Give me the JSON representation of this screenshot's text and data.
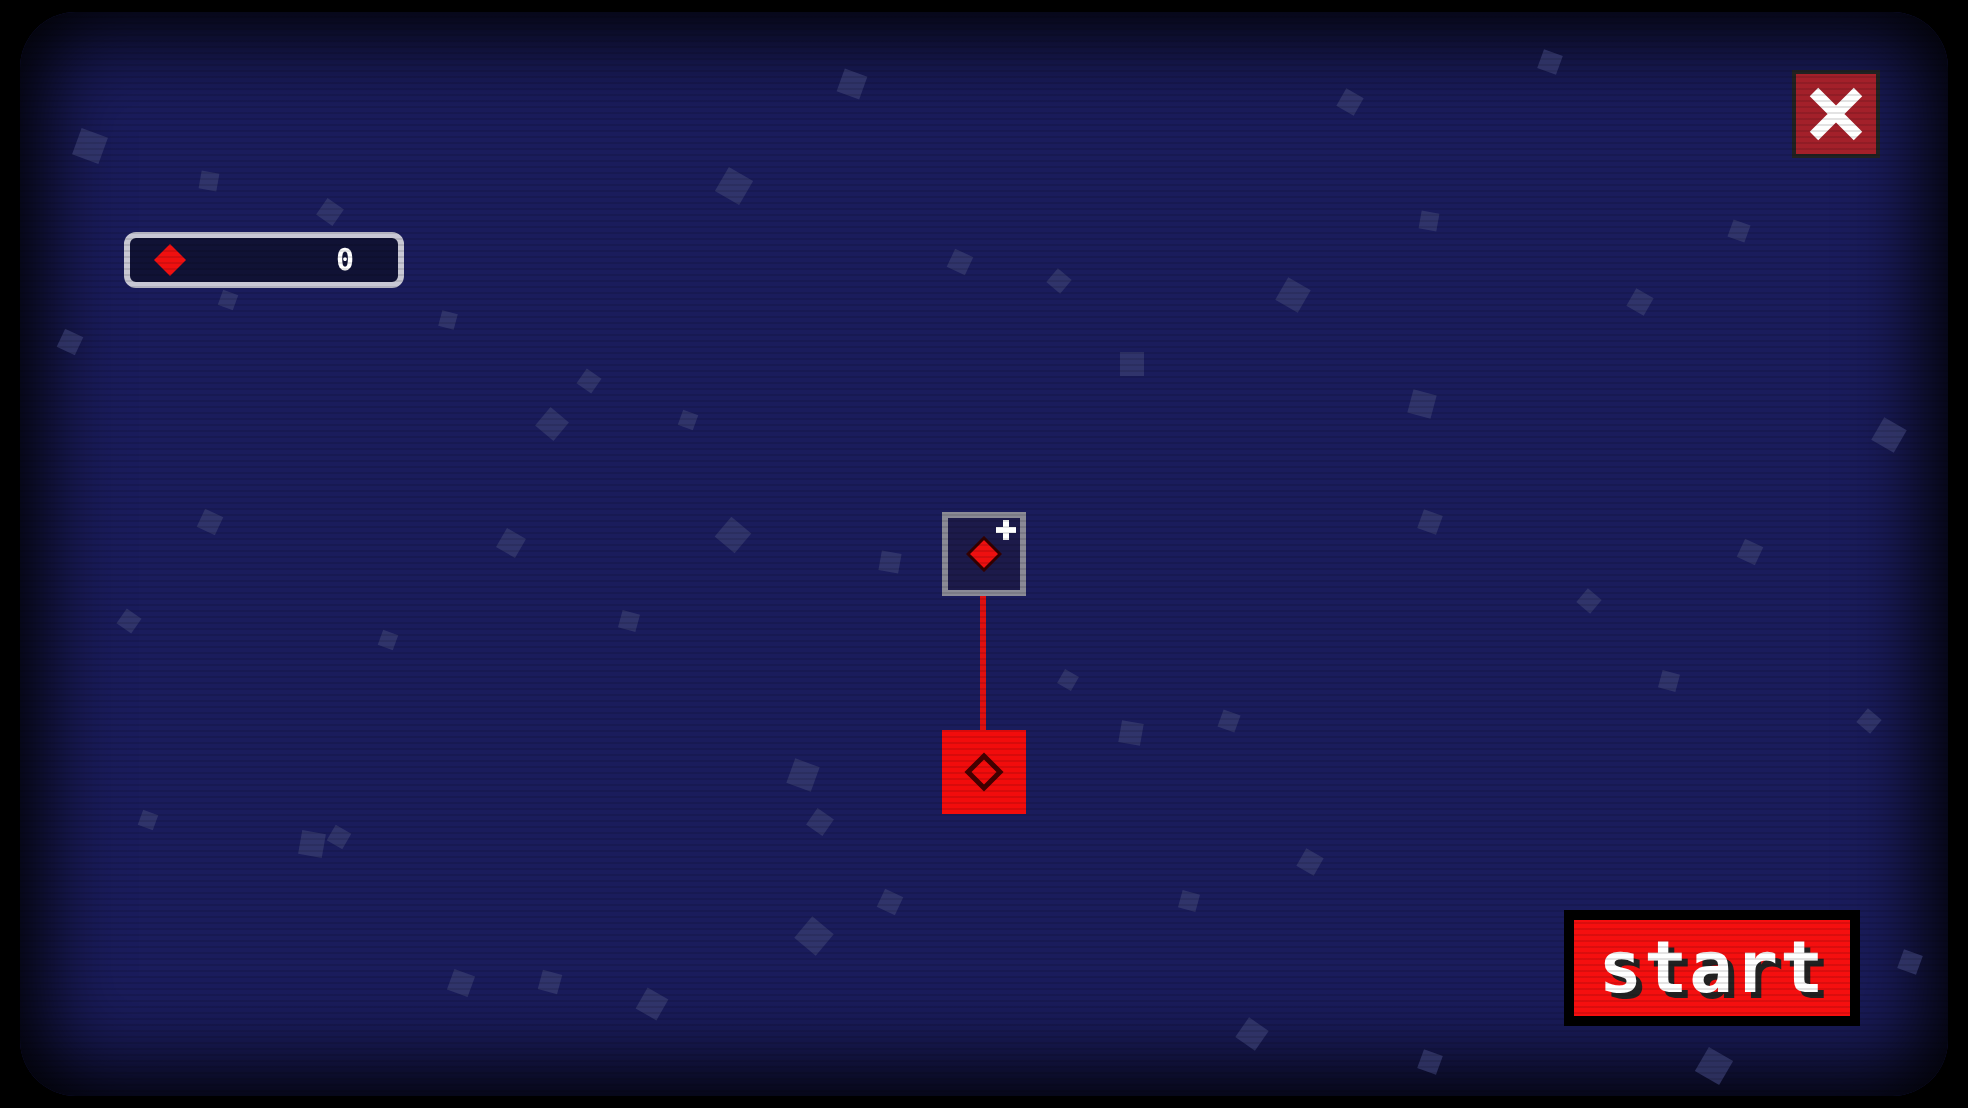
{
  "currency": {
    "amount": "0"
  },
  "skill_tree": {
    "nodes": [
      {
        "selected": false,
        "new": true
      },
      {
        "selected": true,
        "new": false
      }
    ]
  },
  "start_button": {
    "label": "start"
  }
}
